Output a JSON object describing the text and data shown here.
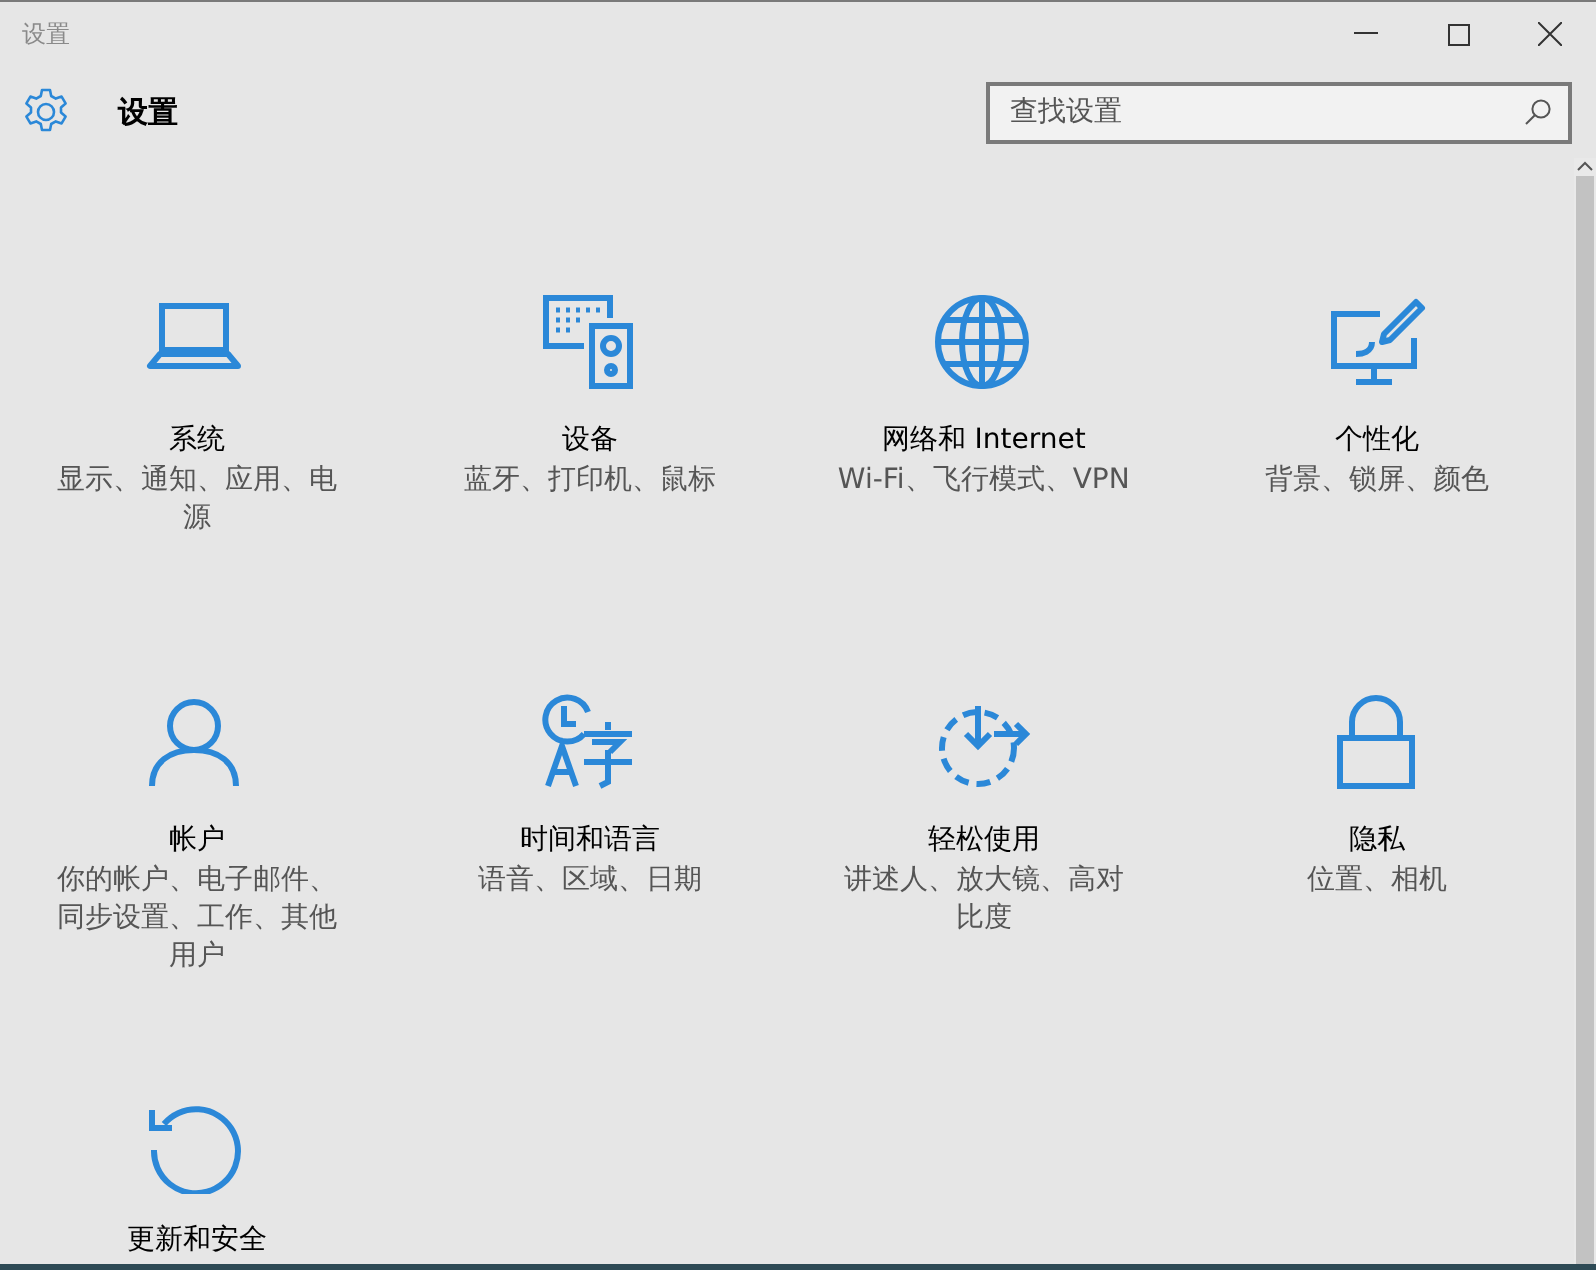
{
  "window": {
    "title": "设置"
  },
  "header": {
    "title": "设置"
  },
  "search": {
    "placeholder": "查找设置"
  },
  "categories": [
    {
      "kind": "laptop",
      "title": "系统",
      "description": "显示、通知、应用、电源"
    },
    {
      "kind": "devices",
      "title": "设备",
      "description": "蓝牙、打印机、鼠标"
    },
    {
      "kind": "globe",
      "title": "网络和 Internet",
      "description": "Wi-Fi、飞行模式、VPN"
    },
    {
      "kind": "paint",
      "title": "个性化",
      "description": "背景、锁屏、颜色"
    },
    {
      "kind": "person",
      "title": "帐户",
      "description": "你的帐户、电子邮件、同步设置、工作、其他用户"
    },
    {
      "kind": "language",
      "title": "时间和语言",
      "description": "语音、区域、日期"
    },
    {
      "kind": "ease",
      "title": "轻松使用",
      "description": "讲述人、放大镜、高对比度"
    },
    {
      "kind": "lock",
      "title": "隐私",
      "description": "位置、相机"
    },
    {
      "kind": "update",
      "title": "更新和安全"
    }
  ]
}
